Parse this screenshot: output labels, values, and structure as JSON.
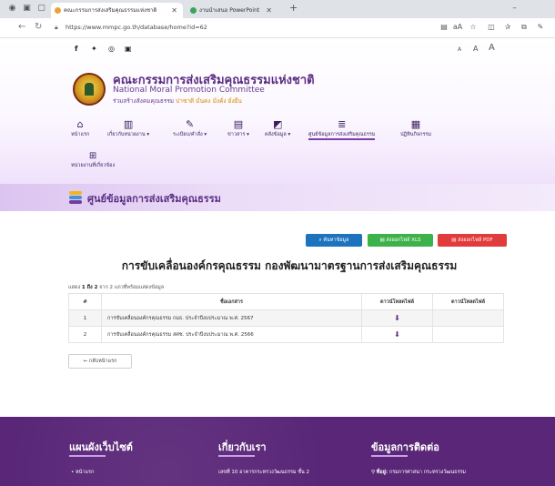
{
  "browser": {
    "tabs": [
      {
        "label": "คณะกรรมการส่งเสริมคุณธรรมแห่งชาติ",
        "active": true,
        "favicon_color": "#e8a23a"
      },
      {
        "label": "งานนำเสนอ PowerPoint",
        "active": false,
        "favicon_color": "#3aa55a"
      }
    ],
    "url": "https://www.mmpc.go.th/database/home?id=62",
    "zoom_text": "aA"
  },
  "site": {
    "name_th": "คณะกรรมการส่งเสริมคุณธรรมแห่งชาติ",
    "name_en": "National Moral Promotion Committee",
    "slogan_prefix": "ร่วมสร้างสังคมคุณธรรม ",
    "slogan_highlight": "ปาซาติ มั่นคง มั่งคั่ง ยั่งยืน",
    "font_small": "A",
    "font_medium": "A",
    "font_large": "A"
  },
  "menu": [
    {
      "label": "หน้าแรก",
      "icon": "home-icon"
    },
    {
      "label": "เกี่ยวกับหน่วยงาน ▾",
      "icon": "building-icon"
    },
    {
      "label": "ระเบียบ/คำสั่ง ▾",
      "icon": "edit-icon"
    },
    {
      "label": "ข่าวสาร ▾",
      "icon": "news-icon"
    },
    {
      "label": "คลังข้อมูล ▾",
      "icon": "images-icon"
    },
    {
      "label": "ศูนย์ข้อมูลการส่งเสริมคุณธรรม",
      "icon": "database-icon"
    },
    {
      "label": "ปฏิทินกิจกรรม",
      "icon": "calendar-icon"
    }
  ],
  "menu_extra": {
    "label": "หน่วยงานที่เกี่ยวข้อง",
    "icon": "sitemap-icon"
  },
  "page": {
    "section_title": "ศูนย์ข้อมูลการส่งเสริมคุณธรรม",
    "search_button": "ค้นหาข้อมูล",
    "export_xls": "ส่งออกไฟล์ XLS",
    "export_pdf": "ส่งออกไฟล์ PDF",
    "doc_title": "การขับเคลื่อนองค์กรคุณธรรม กองพัฒนามาตรฐานการส่งเสริมคุณธรรม",
    "showing_prefix": "แสดง ",
    "showing_range": "1 ถึง 2",
    "showing_suffix": " จาก 2 แถวที่พร้อมแสดงข้อมูล",
    "back_button": "กลับหน้าแรก"
  },
  "table": {
    "headers": [
      "#",
      "ชื่อเอกสาร",
      "ดาวน์โหลดไฟล์",
      "ดาวน์โหลดไฟล์"
    ],
    "rows": [
      {
        "no": "1",
        "name": "การขับเคลื่อนองค์กรคุณธรรม กมธ. ประจำปีงบประมาณ พ.ศ. 2567"
      },
      {
        "no": "2",
        "name": "การขับเคลื่อนองค์กรคุณธรรม สศช. ประจำปีงบประมาณ พ.ศ. 2566"
      }
    ]
  },
  "footer": {
    "col1_title": "แผนผังเว็บไซต์",
    "col1_item": "• หน้าแรก",
    "col2_title": "เกี่ยวกับเรา",
    "col2_text": "เลขที่ 10 อาคารกระทรวงวัฒนธรรม ชั้น 2",
    "col3_title": "ข้อมูลการติดต่อ",
    "col3_label": "ที่อยู่:",
    "col3_text": " กรมการศาสนา กระทรวงวัฒนธรรม"
  },
  "colors": {
    "brand_purple": "#5a2d82",
    "footer_purple": "#5a2778",
    "btn_blue": "#1e73be",
    "btn_green": "#3eb24a",
    "btn_red": "#e23b3b"
  }
}
